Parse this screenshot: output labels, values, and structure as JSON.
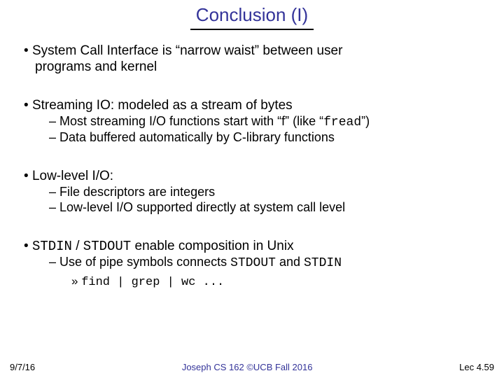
{
  "title": "Conclusion (I)",
  "bullets": {
    "b1_text_a": "System Call Interface is “narrow waist” between user",
    "b1_text_b": "programs and kernel",
    "b2_text": "Streaming IO: modeled as a stream of bytes",
    "b2_sub1_a": "Most streaming I/O functions start with “f” (like “",
    "b2_sub1_code": "fread",
    "b2_sub1_b": "”)",
    "b2_sub2": "Data buffered automatically by C-library functions",
    "b3_text": "Low-level I/O:",
    "b3_sub1": "File descriptors are integers",
    "b3_sub2": "Low-level I/O supported directly at system call level",
    "b4_code1": "STDIN",
    "b4_mid": " / ",
    "b4_code2": "STDOUT",
    "b4_rest": " enable composition in Unix",
    "b4_sub1_a": "Use of pipe symbols connects ",
    "b4_sub1_code1": "STDOUT",
    "b4_sub1_mid": " and ",
    "b4_sub1_code2": "STDIN",
    "b4_sub2_code": "find | grep | wc ..."
  },
  "footer": {
    "left": "9/7/16",
    "center": "Joseph CS 162 ©UCB Fall 2016",
    "right": "Lec 4.59"
  }
}
